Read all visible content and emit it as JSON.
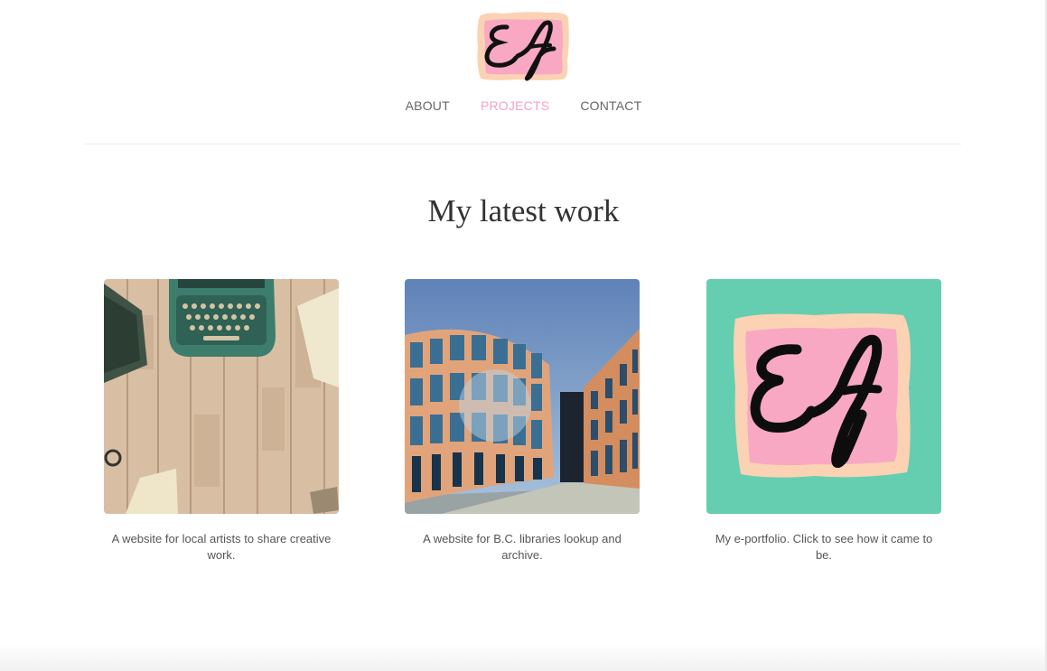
{
  "site": {
    "logo_text": "Ef"
  },
  "nav": {
    "items": [
      {
        "label": "ABOUT",
        "active": false
      },
      {
        "label": "PROJECTS",
        "active": true
      },
      {
        "label": "CONTACT",
        "active": false
      }
    ]
  },
  "main": {
    "title": "My latest work",
    "projects": [
      {
        "image": "typewriter-desk-photo",
        "caption": "A website for local artists to share creative work."
      },
      {
        "image": "library-building-painting",
        "caption": "A website for B.C. libraries lookup and archive."
      },
      {
        "image": "ef-logo-on-teal",
        "caption": "My e-portfolio. Click to see how it came to be."
      }
    ]
  },
  "colors": {
    "accent_pink": "#f4a3bb",
    "logo_pink": "#f9a8c4",
    "logo_border": "#fbd2b4",
    "teal": "#66ceb0",
    "text": "#555555",
    "heading": "#333333"
  }
}
